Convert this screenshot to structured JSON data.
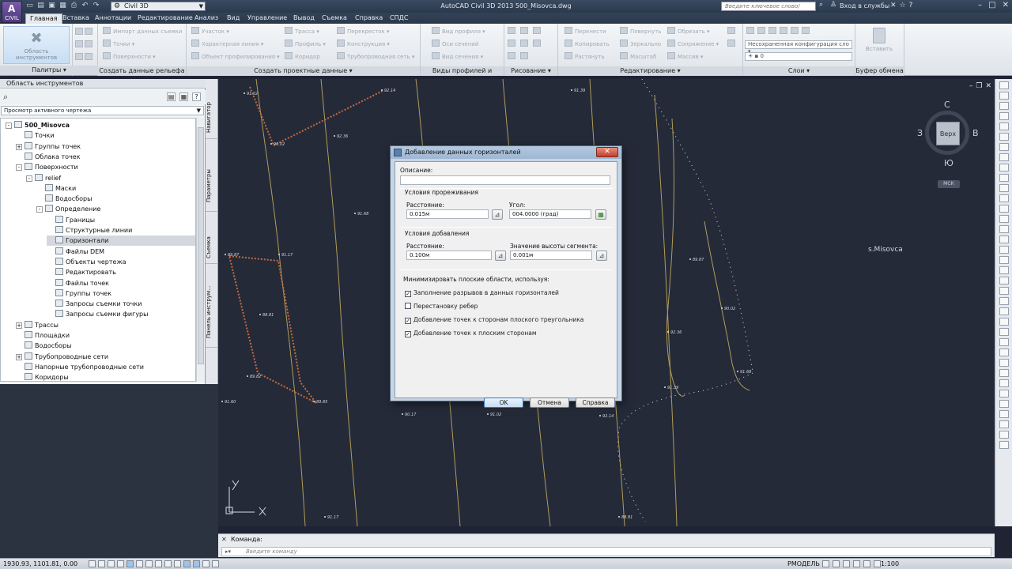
{
  "titlebar": {
    "app_button": "CIVIL",
    "workspace": "Civil 3D",
    "title": "AutoCAD Civil 3D 2013    500_Misovca.dwg",
    "search_placeholder": "Введите ключевое слово/фразу",
    "login": "Вход в службы"
  },
  "tabs": [
    "Главная",
    "Вставка",
    "Аннотации",
    "Редактирование",
    "Анализ",
    "Вид",
    "Управление",
    "Вывод",
    "Съемка",
    "Справка",
    "СПДС"
  ],
  "ribbon": {
    "toolspace_btn": "Область инструментов",
    "panels": {
      "palettes": "Палитры",
      "create_ground": "Создать данные рельефа",
      "create_design": "Создать проектные данные",
      "profile_views": "Виды профилей и сечений",
      "draw": "Рисование",
      "modify": "Редактирование",
      "layers": "Слои",
      "clipboard": "Буфер обмена"
    },
    "create_ground_items": [
      "Импорт данных съемки",
      "Точки",
      "Поверхности"
    ],
    "design_items_col1": [
      "Участок",
      "Характерная линия",
      "Объект профилирования"
    ],
    "design_items_col2": [
      "Трасса",
      "Профиль",
      "Коридор"
    ],
    "design_items_col3": [
      "Перекресток",
      "Конструкция",
      "Трубопроводная сеть"
    ],
    "profile_items": [
      "Вид профиля",
      "Оси сечений",
      "Вид сечения"
    ],
    "modify_col1": [
      "Перенести",
      "Копировать",
      "Растянуть"
    ],
    "modify_col2": [
      "Повернуть",
      "Зеркально",
      "Масштаб"
    ],
    "modify_col3": [
      "Обрезать",
      "Сопряжение",
      "Массив"
    ],
    "layer_config": "Несохраненная конфигурация сло",
    "layer_name": "0",
    "paste": "Вставить"
  },
  "toolspace": {
    "title": "Область инструментов",
    "view": "Просмотр активного чертежа",
    "tree": [
      {
        "label": "500_Misovca",
        "level": 0,
        "toggle": "-",
        "bold": true
      },
      {
        "label": "Точки",
        "level": 1
      },
      {
        "label": "Группы точек",
        "level": 1,
        "toggle": "+"
      },
      {
        "label": "Облака точек",
        "level": 1
      },
      {
        "label": "Поверхности",
        "level": 1,
        "toggle": "-"
      },
      {
        "label": "relief",
        "level": 2,
        "toggle": "-"
      },
      {
        "label": "Маски",
        "level": 3
      },
      {
        "label": "Водосборы",
        "level": 3
      },
      {
        "label": "Определение",
        "level": 3,
        "toggle": "-"
      },
      {
        "label": "Границы",
        "level": 4
      },
      {
        "label": "Структурные линии",
        "level": 4
      },
      {
        "label": "Горизонтали",
        "level": 4,
        "selected": true
      },
      {
        "label": "Файлы DEM",
        "level": 4
      },
      {
        "label": "Объекты чертежа",
        "level": 4
      },
      {
        "label": "Редактировать",
        "level": 4
      },
      {
        "label": "Файлы точек",
        "level": 4
      },
      {
        "label": "Группы точек",
        "level": 4
      },
      {
        "label": "Запросы съемки точки",
        "level": 4
      },
      {
        "label": "Запросы съемки фигуры",
        "level": 4
      },
      {
        "label": "Трассы",
        "level": 1,
        "toggle": "+"
      },
      {
        "label": "Площадки",
        "level": 1
      },
      {
        "label": "Водосборы",
        "level": 1
      },
      {
        "label": "Трубопроводные сети",
        "level": 1,
        "toggle": "+"
      },
      {
        "label": "Напорные трубопроводные сети",
        "level": 1
      },
      {
        "label": "Коридоры",
        "level": 1
      }
    ],
    "vtabs": [
      "Навигатор",
      "Параметры",
      "Съемка",
      "Панель инструм..."
    ]
  },
  "drawing": {
    "viewcube": {
      "top": "Верх",
      "n": "С",
      "s": "Ю",
      "w": "З",
      "e": "В",
      "wcs": "МСК"
    },
    "label": "s.Misovca",
    "elevations": [
      "91.02",
      "92.14",
      "91.39",
      "90.02",
      "92.36",
      "91.68",
      "89.87",
      "91.17",
      "88.81",
      "89.82",
      "91.60",
      "89.85",
      "90.17"
    ]
  },
  "dialog": {
    "title": "Добавление данных горизонталей",
    "description_label": "Описание:",
    "description_value": "",
    "weeding_title": "Условия прореживания",
    "distance_label": "Расстояние:",
    "weed_distance": "0.015м",
    "angle_label": "Угол:",
    "weed_angle": "004.0000 (град)",
    "supplement_title": "Условия добавления",
    "supp_distance_label": "Расстояние:",
    "supp_distance": "0.100м",
    "midordinate_label": "Значение высоты сегмента:",
    "midordinate": "0.001м",
    "minimize_title": "Минимизировать плоские области, используя:",
    "options": [
      {
        "label": "Заполнение разрывов в данных горизонталей",
        "checked": true
      },
      {
        "label": "Перестановку ребер",
        "checked": false
      },
      {
        "label": "Добавление точек к сторонам плоского треугольника",
        "checked": true
      },
      {
        "label": "Добавление точек к плоским сторонам",
        "checked": true
      }
    ],
    "ok": "OK",
    "cancel": "Отмена",
    "help": "Справка"
  },
  "command": {
    "history": "Команда:",
    "placeholder": "Введите команду"
  },
  "status": {
    "coords": "1930.93, 1101.81, 0.00",
    "model": "РМОДЕЛЬ",
    "scale": "1:100"
  },
  "colors": {
    "drawing_bg": "#242a38",
    "contour": "#c9b060",
    "boundary": "#c86a3c",
    "dialog_frame": "#c6d5e6"
  }
}
